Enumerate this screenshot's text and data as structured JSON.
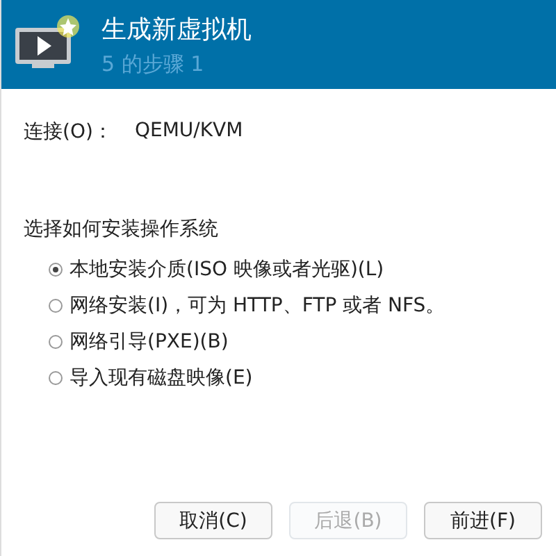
{
  "header": {
    "title": "生成新虚拟机",
    "subtitle": "5 的步骤 1"
  },
  "connection": {
    "label": "连接(O)：",
    "value": "QEMU/KVM"
  },
  "install": {
    "heading": "选择如何安装操作系统",
    "options": [
      {
        "label": "本地安装介质(ISO 映像或者光驱)(L)",
        "selected": true
      },
      {
        "label": "网络安装(I)，可为 HTTP、FTP 或者 NFS。",
        "selected": false
      },
      {
        "label": "网络引导(PXE)(B)",
        "selected": false
      },
      {
        "label": "导入现有磁盘映像(E)",
        "selected": false
      }
    ]
  },
  "buttons": [
    {
      "label": "取消(C)",
      "disabled": false
    },
    {
      "label": "后退(B)",
      "disabled": true
    },
    {
      "label": "前进(F)",
      "disabled": false
    }
  ]
}
